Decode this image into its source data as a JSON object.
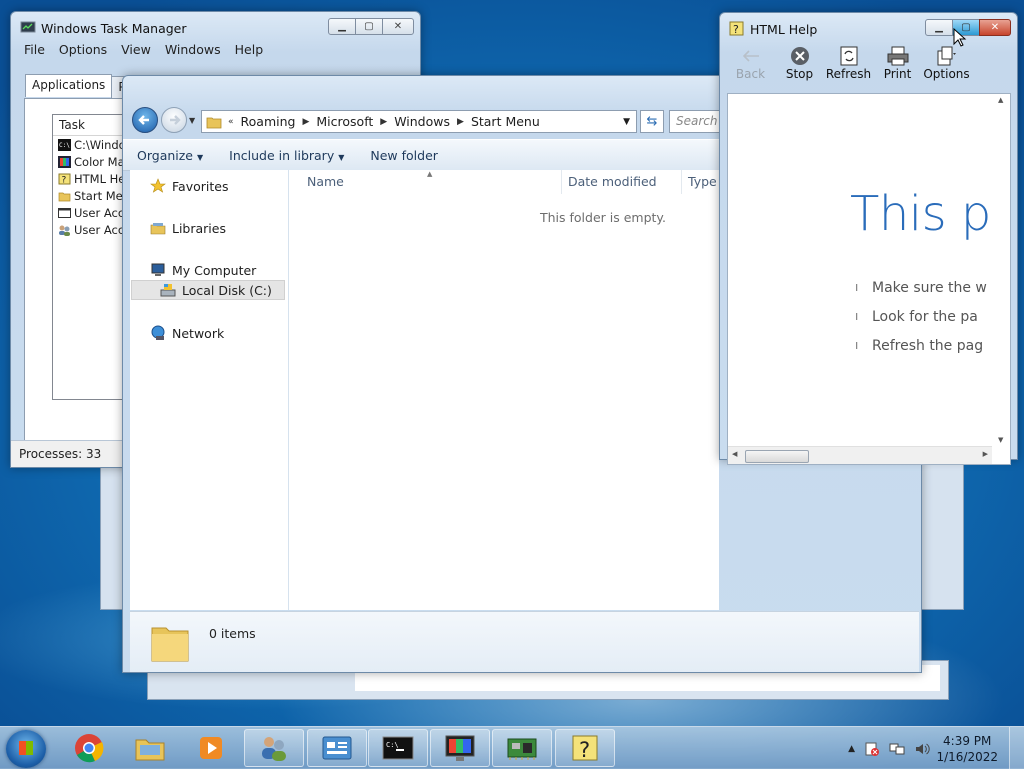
{
  "colors": {
    "accent": "#2a6cba",
    "titlebar": "#c9dcef",
    "desktop": "#1071b8"
  },
  "task_manager": {
    "title": "Windows Task Manager",
    "menu": [
      "File",
      "Options",
      "View",
      "Windows",
      "Help"
    ],
    "tabs": [
      "Applications",
      "Proce"
    ],
    "list_header": "Task",
    "tasks": [
      {
        "label": "C:\\Windows",
        "icon": "cmd-icon"
      },
      {
        "label": "Color Manag",
        "icon": "color-management-icon"
      },
      {
        "label": "HTML Help",
        "icon": "help-icon"
      },
      {
        "label": "Start Menu",
        "icon": "folder-icon"
      },
      {
        "label": "User Accour",
        "icon": "window-icon"
      },
      {
        "label": "User Accour",
        "icon": "users-icon"
      }
    ],
    "status": "Processes: 33"
  },
  "explorer": {
    "breadcrumb": [
      "Roaming",
      "Microsoft",
      "Windows",
      "Start Menu"
    ],
    "breadcrumb_prefix": "«",
    "search_placeholder": "Search",
    "commands": {
      "organize": "Organize",
      "include": "Include in library",
      "new_folder": "New folder"
    },
    "nav": {
      "favorites": "Favorites",
      "libraries": "Libraries",
      "computer": "My Computer",
      "disk": "Local Disk (C:)",
      "network": "Network"
    },
    "columns": {
      "name": "Name",
      "date": "Date modified",
      "type": "Type"
    },
    "empty_message": "This folder is empty.",
    "item_count": "0 items"
  },
  "html_help": {
    "title": "HTML Help",
    "toolbar": {
      "back": "Back",
      "stop": "Stop",
      "refresh": "Refresh",
      "print": "Print",
      "options": "Options"
    },
    "heading": "This pa",
    "bullets": [
      "Make sure the w",
      "Look for the pa",
      "Refresh the pag"
    ]
  },
  "taskbar": {
    "time": "4:39 PM",
    "date": "1/16/2022",
    "items": [
      "explorer-icon",
      "chrome-icon",
      "media-player-icon",
      "users-icon",
      "control-panel-icon",
      "cmd-icon",
      "display-icon",
      "hardware-icon",
      "help-icon"
    ]
  }
}
